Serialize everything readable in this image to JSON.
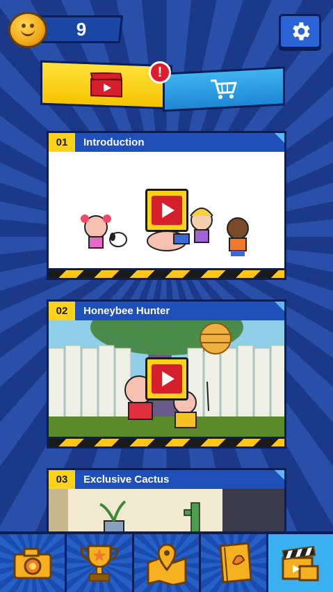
{
  "header": {
    "coins": "9"
  },
  "tabs": {
    "videos_icon": "clapperboard-icon",
    "shop_icon": "shopping-cart-icon",
    "alert": "!"
  },
  "episodes": [
    {
      "number": "01",
      "title": "Introduction"
    },
    {
      "number": "02",
      "title": "Honeybee Hunter"
    },
    {
      "number": "03",
      "title": "Exclusive Cactus"
    }
  ],
  "bottom_nav": [
    {
      "name": "camera",
      "icon": "camera-icon"
    },
    {
      "name": "trophy",
      "icon": "trophy-icon"
    },
    {
      "name": "map",
      "icon": "map-pin-icon"
    },
    {
      "name": "book",
      "icon": "book-icon"
    },
    {
      "name": "videos",
      "icon": "clapperboard-icon",
      "active": true
    }
  ],
  "colors": {
    "background": "#1e3f95",
    "accent_yellow": "#ffd21a",
    "play_red": "#d61f2c",
    "active_tab": "#3bb0f0"
  }
}
